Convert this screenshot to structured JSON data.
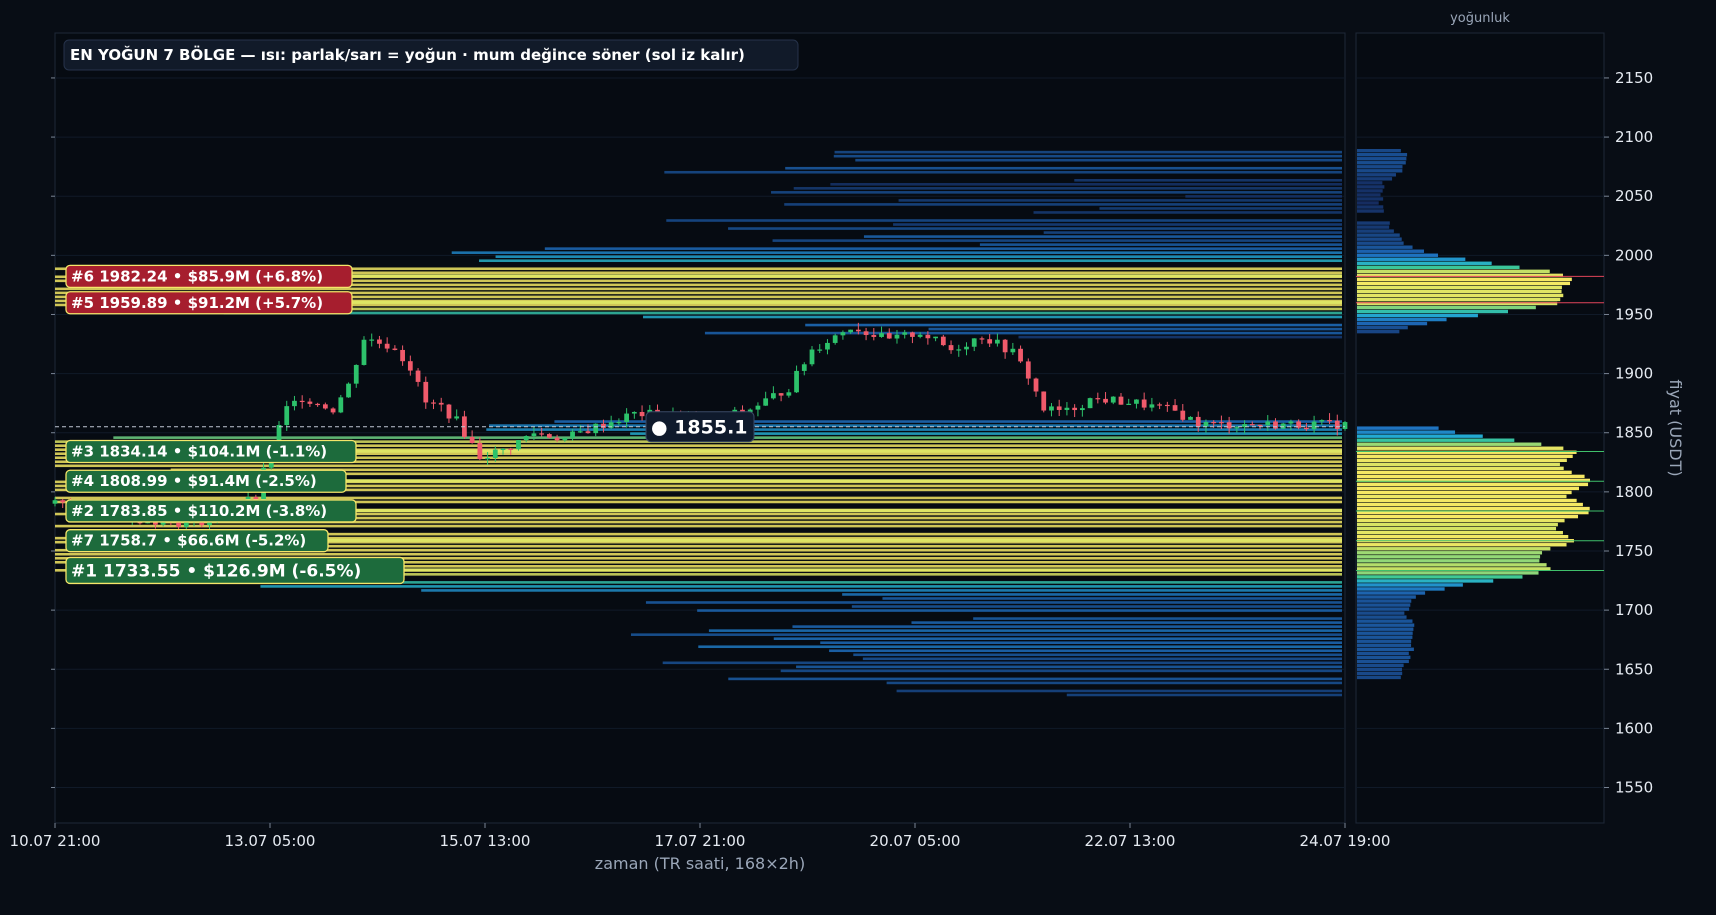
{
  "chart_data": {
    "type": "candlestick-heatmap",
    "title": "EN YOĞUN 7 BÖLGE — ısı: parlak/sarı = yoğun · mum değince söner (sol iz kalır)",
    "xlabel": "zaman (TR saati, 168×2h)",
    "ylabel": "fiyat (USDT)",
    "profile_label": "yoğunluk",
    "ylim": [
      1520,
      2188
    ],
    "yticks": [
      1550,
      1600,
      1650,
      1700,
      1750,
      1800,
      1850,
      1900,
      1950,
      2000,
      2050,
      2100,
      2150
    ],
    "xticks": [
      "10.07 21:00",
      "13.07 05:00",
      "15.07 13:00",
      "17.07 21:00",
      "20.07 05:00",
      "22.07 13:00",
      "24.07 19:00"
    ],
    "current_price": 1855.1,
    "current_price_label": "● 1855.1",
    "zones": [
      {
        "rank": 6,
        "label": "#6  1982.24  •  $85.9M  (+6.8%)",
        "price": 1982.24,
        "side": "above"
      },
      {
        "rank": 5,
        "label": "#5  1959.89  •  $91.2M  (+5.7%)",
        "price": 1959.89,
        "side": "above"
      },
      {
        "rank": 3,
        "label": "#3  1834.14  •  $104.1M  (-1.1%)",
        "price": 1834.14,
        "side": "below"
      },
      {
        "rank": 4,
        "label": "#4  1808.99  •  $91.4M  (-2.5%)",
        "price": 1808.99,
        "side": "below"
      },
      {
        "rank": 2,
        "label": "#2  1783.85  •  $110.2M  (-3.8%)",
        "price": 1783.85,
        "side": "below"
      },
      {
        "rank": 7,
        "label": "#7  1758.7  •  $66.6M  (-5.2%)",
        "price": 1758.7,
        "side": "below"
      },
      {
        "rank": 1,
        "label": "#1  1733.55  •  $126.9M  (-6.5%)",
        "price": 1733.55,
        "side": "below"
      }
    ],
    "anchors": [
      [
        0,
        1790
      ],
      [
        10,
        1778
      ],
      [
        18,
        1773
      ],
      [
        26,
        1795
      ],
      [
        28,
        1838
      ],
      [
        30,
        1870
      ],
      [
        32,
        1880
      ],
      [
        36,
        1870
      ],
      [
        38,
        1890
      ],
      [
        40,
        1930
      ],
      [
        44,
        1922
      ],
      [
        46,
        1905
      ],
      [
        48,
        1875
      ],
      [
        50,
        1872
      ],
      [
        52,
        1860
      ],
      [
        55,
        1830
      ],
      [
        58,
        1835
      ],
      [
        62,
        1850
      ],
      [
        66,
        1845
      ],
      [
        70,
        1855
      ],
      [
        75,
        1866
      ],
      [
        80,
        1865
      ],
      [
        85,
        1860
      ],
      [
        90,
        1870
      ],
      [
        95,
        1888
      ],
      [
        98,
        1920
      ],
      [
        103,
        1940
      ],
      [
        108,
        1928
      ],
      [
        112,
        1935
      ],
      [
        116,
        1920
      ],
      [
        120,
        1932
      ],
      [
        124,
        1918
      ],
      [
        126,
        1898
      ],
      [
        128,
        1870
      ],
      [
        131,
        1868
      ],
      [
        134,
        1878
      ],
      [
        136,
        1878
      ],
      [
        140,
        1875
      ],
      [
        145,
        1868
      ],
      [
        148,
        1858
      ],
      [
        150,
        1857
      ]
    ],
    "colors": {
      "up": "#2dc26b",
      "down": "#f05a6b",
      "above": "#a61e2e",
      "below": "#1d6b3c",
      "highlight": "#f5e66a"
    }
  }
}
